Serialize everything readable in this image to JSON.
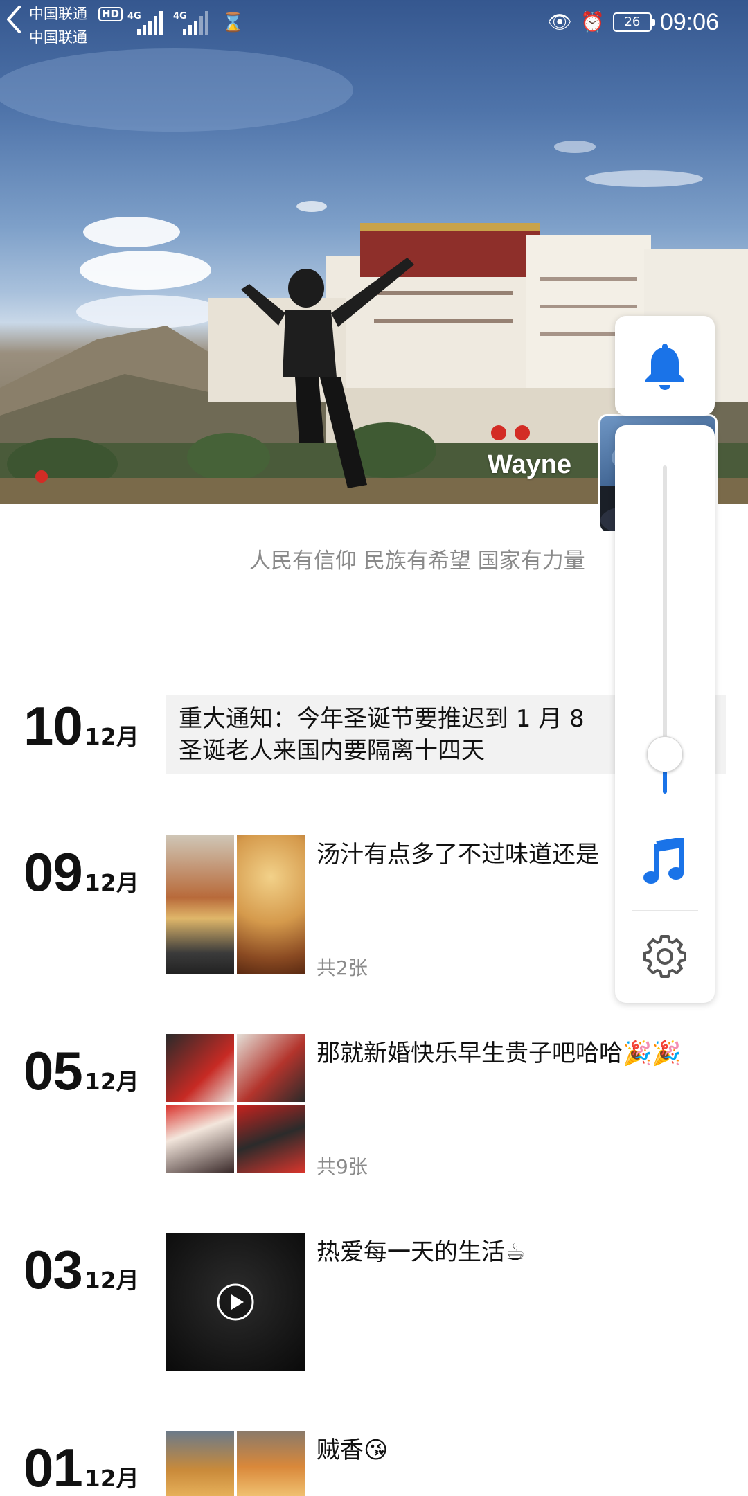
{
  "status_bar": {
    "carrier_1": "中国联通",
    "carrier_2": "中国联通",
    "hd_badge": "HD",
    "network_1": "4G",
    "network_2": "4G",
    "battery": "26",
    "time": "09:06"
  },
  "profile": {
    "name": "Wayne",
    "signature": "人民有信仰 民族有希望 国家有力量"
  },
  "posts": [
    {
      "day": "10",
      "month": "12月",
      "text_line_1": "重大通知：今年圣诞节要推迟到 1 月 8",
      "text_line_2": "圣诞老人来国内要隔离十四天"
    },
    {
      "day": "09",
      "month": "12月",
      "caption": "汤汁有点多了不过味道还是",
      "count": "共2张"
    },
    {
      "day": "05",
      "month": "12月",
      "caption": "那就新婚快乐早生贵子吧哈哈🎉🎉",
      "count": "共9张"
    },
    {
      "day": "03",
      "month": "12月",
      "caption": "热爱每一天的生活☕"
    },
    {
      "day": "01",
      "month": "12月",
      "caption": "贼香😘"
    }
  ],
  "panel": {
    "volume_level": 0.12,
    "accent": "#1a73e8"
  }
}
